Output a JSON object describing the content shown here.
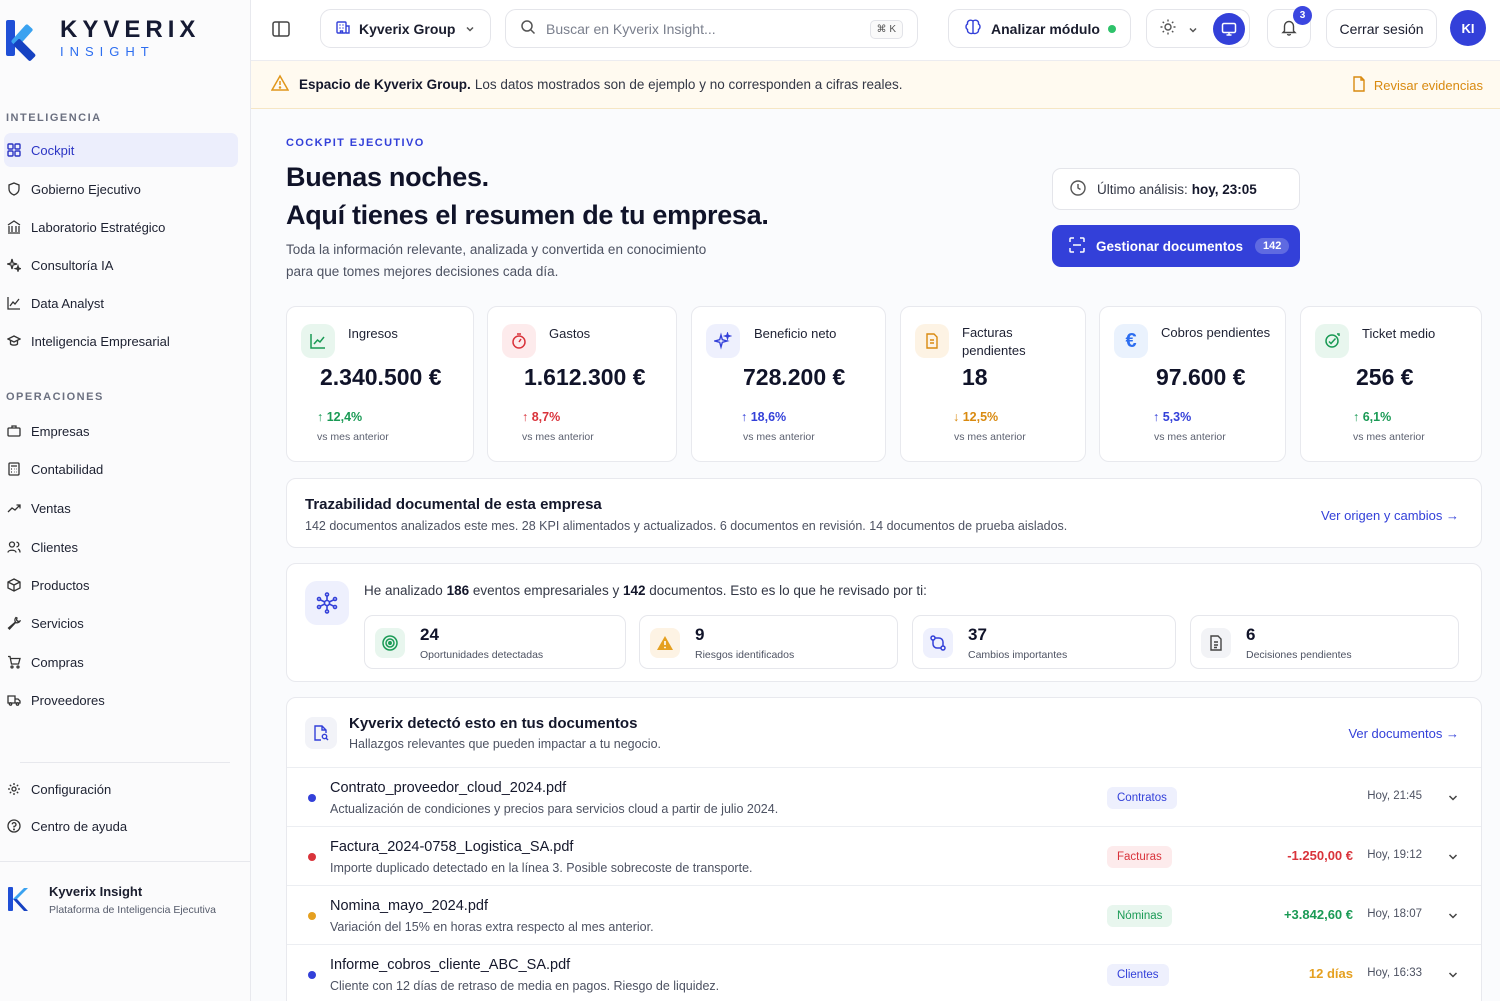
{
  "brand": {
    "name": "KYVERIX",
    "sub": "INSIGHT"
  },
  "sidebar": {
    "section_intel": "INTELIGENCIA",
    "intel_items": [
      {
        "label": "Cockpit"
      },
      {
        "label": "Gobierno Ejecutivo"
      },
      {
        "label": "Laboratorio Estratégico"
      },
      {
        "label": "Consultoría IA"
      },
      {
        "label": "Data Analyst"
      },
      {
        "label": "Inteligencia Empresarial"
      }
    ],
    "section_ops": "OPERACIONES",
    "ops_items": [
      {
        "label": "Empresas"
      },
      {
        "label": "Contabilidad"
      },
      {
        "label": "Ventas"
      },
      {
        "label": "Clientes"
      },
      {
        "label": "Productos"
      },
      {
        "label": "Servicios"
      },
      {
        "label": "Compras"
      },
      {
        "label": "Proveedores"
      }
    ],
    "bottom_items": [
      {
        "label": "Configuración"
      },
      {
        "label": "Centro de ayuda"
      }
    ],
    "footer": {
      "title": "Kyverix Insight",
      "subtitle": "Plataforma de Inteligencia Ejecutiva"
    }
  },
  "topbar": {
    "org": "Kyverix Group",
    "search_placeholder": "Buscar en Kyverix Insight...",
    "search_shortcut": "⌘ K",
    "analyze_label": "Analizar módulo",
    "notifications_count": "3",
    "logout_label": "Cerrar sesión",
    "avatar_initials": "KI"
  },
  "banner": {
    "bold": "Espacio de Kyverix Group.",
    "text": "Los datos mostrados son de ejemplo y no corresponden a cifras reales.",
    "link": "Revisar evidencias"
  },
  "hero": {
    "eyebrow": "COCKPIT EJECUTIVO",
    "title_line1": "Buenas noches.",
    "title_line2": "Aquí tienes el resumen de tu empresa.",
    "intro_line1": "Toda la información relevante, analizada y convertida en conocimiento",
    "intro_line2": "para que tomes mejores decisiones cada día.",
    "last_analysis_label": "Último análisis:",
    "last_analysis_value": "hoy, 23:05",
    "manage_label": "Gestionar documentos",
    "manage_count": "142"
  },
  "kpis": [
    {
      "label": "Ingresos",
      "value": "2.340.500 €",
      "delta": "↑ 12,4%",
      "sub": "vs mes anterior"
    },
    {
      "label": "Gastos",
      "value": "1.612.300 €",
      "delta": "↑ 8,7%",
      "sub": "vs mes anterior"
    },
    {
      "label": "Beneficio neto",
      "value": "728.200 €",
      "delta": "↑ 18,6%",
      "sub": "vs mes anterior"
    },
    {
      "label": "Facturas pendientes",
      "value": "18",
      "delta": "↓ 12,5%",
      "sub": "vs mes anterior"
    },
    {
      "label": "Cobros pendientes",
      "value": "97.600 €",
      "delta": "↑ 5,3%",
      "sub": "vs mes anterior"
    },
    {
      "label": "Ticket medio",
      "value": "256 €",
      "delta": "↑ 6,1%",
      "sub": "vs mes anterior"
    }
  ],
  "trace": {
    "title": "Trazabilidad documental de esta empresa",
    "subtitle": "142 documentos analizados este mes. 28 KPI alimentados y actualizados. 6 documentos en revisión. 14 documentos de prueba aislados.",
    "link": "Ver origen y cambios →"
  },
  "analysis": {
    "pre": "He analizado",
    "events": "186",
    "mid": "eventos empresariales y",
    "docs": "142",
    "post": "documentos. Esto es lo que he revisado por ti:",
    "stats": [
      {
        "num": "24",
        "label": "Oportunidades detectadas"
      },
      {
        "num": "9",
        "label": "Riesgos identificados"
      },
      {
        "num": "37",
        "label": "Cambios importantes"
      },
      {
        "num": "6",
        "label": "Decisiones pendientes"
      }
    ]
  },
  "findings": {
    "title": "Kyverix detectó esto en tus documentos",
    "subtitle": "Hallazgos relevantes que pueden impactar a tu negocio.",
    "link": "Ver documentos →",
    "rows": [
      {
        "name": "Contrato_proveedor_cloud_2024.pdf",
        "desc": "Actualización de condiciones y precios para servicios cloud a partir de julio 2024.",
        "tag": "Contratos",
        "amount": "",
        "time": "Hoy, 21:45"
      },
      {
        "name": "Factura_2024-0758_Logistica_SA.pdf",
        "desc": "Importe duplicado detectado en la línea 3. Posible sobrecoste de transporte.",
        "tag": "Facturas",
        "amount": "-1.250,00 €",
        "time": "Hoy, 19:12"
      },
      {
        "name": "Nomina_mayo_2024.pdf",
        "desc": "Variación del 15% en horas extra respecto al mes anterior.",
        "tag": "Nóminas",
        "amount": "+3.842,60 €",
        "time": "Hoy, 18:07"
      },
      {
        "name": "Informe_cobros_cliente_ABC_SA.pdf",
        "desc": "Cliente con 12 días de retraso de media en pagos. Riesgo de liquidez.",
        "tag": "Clientes",
        "amount": "12 días",
        "time": "Hoy, 16:33"
      }
    ]
  },
  "colors": {
    "accent": "#3340d9",
    "green": "#1a9a55",
    "red": "#d9333b",
    "amber": "#d98a10"
  }
}
